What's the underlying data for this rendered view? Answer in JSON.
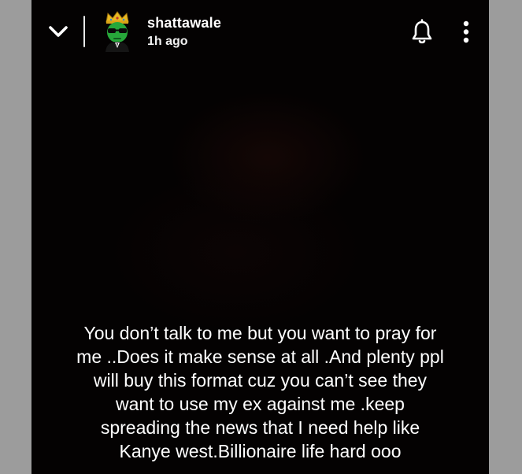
{
  "story": {
    "username": "shattawale",
    "time_ago": "1h ago",
    "caption_lines": [
      "You don’t talk to me but you want to pray for",
      "me ..Does it make sense at all .And plenty ppl",
      "will buy this format cuz you can’t see they",
      "want to use my ex against me .keep",
      "spreading the news that I need help like",
      "Kanye west.Billionaire life hard ooo"
    ]
  },
  "icons": {
    "back": "chevron-down-icon",
    "avatar": "avatar-crowned-alien-icon",
    "notify": "bell-icon",
    "more": "more-vertical-icon"
  },
  "colors": {
    "side_panel": "#9c9c9c",
    "story_background": "#040202",
    "text": "#ffffff",
    "avatar_green": "#27a83a",
    "crown_gold": "#e8b923"
  }
}
